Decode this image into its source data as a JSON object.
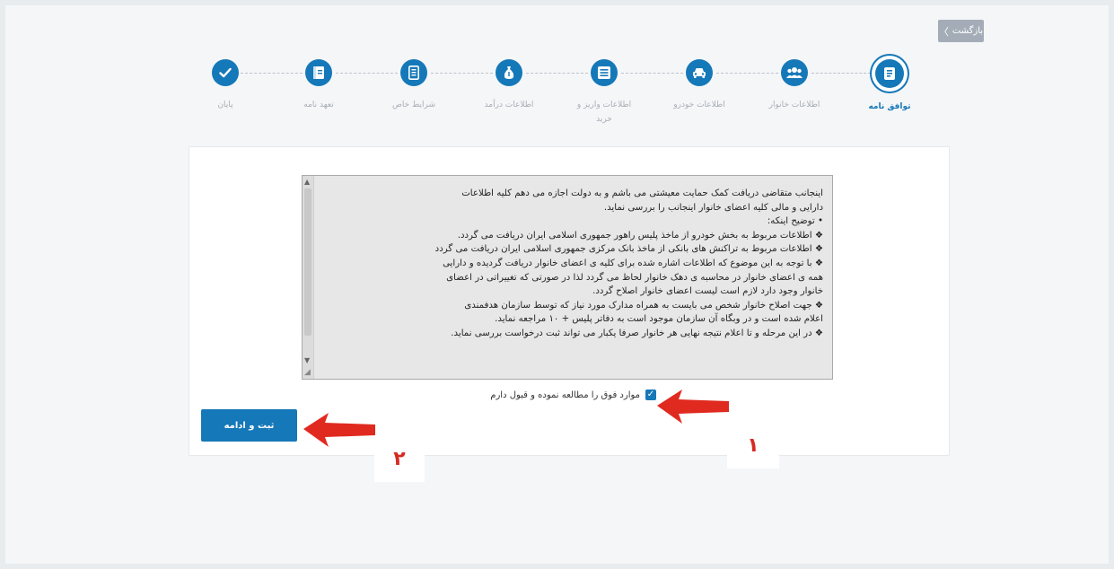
{
  "header": {
    "back_button": {
      "label": "بازگشت",
      "icon": "chevron-right-icon"
    }
  },
  "stepper": {
    "steps": [
      {
        "label": "توافق نامه",
        "icon": "document-icon",
        "state": "active"
      },
      {
        "label": "اطلاعات خانوار",
        "icon": "users-icon",
        "state": "pending"
      },
      {
        "label": "اطلاعات خودرو",
        "icon": "car-icon",
        "state": "pending"
      },
      {
        "label": "اطلاعات واریز و خرید",
        "icon": "list-icon",
        "state": "pending"
      },
      {
        "label": "اطلاعات درآمد",
        "icon": "money-bag-icon",
        "state": "pending"
      },
      {
        "label": "شرایط خاص",
        "icon": "id-card-icon",
        "state": "pending"
      },
      {
        "label": "تعهد نامه",
        "icon": "book-icon",
        "state": "pending"
      },
      {
        "label": "پایان",
        "icon": "check-icon",
        "state": "pending"
      }
    ]
  },
  "terms": {
    "lines": [
      "اینجانب متقاضی دریافت کمک حمایت معیشتی می باشم و به دولت اجازه می دهم کلیه اطلاعات",
      "دارایی و مالی کلیه اعضای خانوار اینجانب را بررسی نماید.",
      "• توضیح اینکه:",
      "❖ اطلاعات مربوط به بخش خودرو از ماخذ پلیس راهور جمهوری اسلامی ایران دریافت می گردد.",
      "❖ اطلاعات مربوط به تراکنش های بانکی از ماخذ بانک مرکزی جمهوری اسلامی ایران دریافت می گردد",
      "❖ با توجه به این موضوع که اطلاعات اشاره شده برای کلیه ی اعضای خانوار دریافت گردیده و دارایی",
      "همه ی اعضای خانوار در محاسبه ی دهک خانوار لحاظ می گردد لذا در صورتی که  تغییراتی در اعضای",
      "خانوار وجود دارد لازم است لیست اعضای خانوار اصلاح گردد.",
      "❖ جهت اصلاح خانوار شخص می بایست به همراه مدارک مورد نیاز که توسط سازمان هدفمندی",
      "اعلام شده است و در وبگاه آن سازمان موجود است به دفاتر پلیس + ۱۰ مراجعه نماید.",
      "❖ در این مرحله و تا اعلام نتیجه نهایی هر خانوار صرفا یکبار می تواند ثبت درخواست بررسی نماید."
    ]
  },
  "agreement": {
    "label": "موارد فوق را مطالعه نموده و قبول دارم",
    "checked": true
  },
  "submit_button": {
    "label": "ثبت و ادامه"
  },
  "annotations": {
    "marker_1": "۱",
    "marker_2": "۲",
    "arrow_color": "#e02a20"
  },
  "colors": {
    "accent": "#1578b8",
    "inactive_label": "#a7aeb5"
  }
}
